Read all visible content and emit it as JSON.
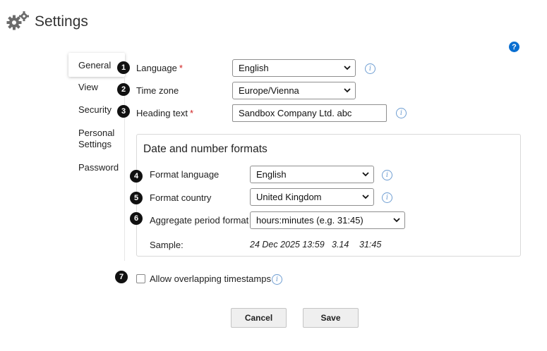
{
  "header": {
    "title": "Settings",
    "icon": "gears-icon",
    "help_glyph": "?"
  },
  "nav": {
    "items": [
      "General",
      "View",
      "Security",
      "Personal Settings",
      "Password"
    ],
    "personal_line1": "Personal",
    "personal_line2": "Settings",
    "active": "General"
  },
  "markers": [
    "1",
    "2",
    "3",
    "4",
    "5",
    "6",
    "7"
  ],
  "form": {
    "language": {
      "label": "Language",
      "required_mark": "*",
      "value": "English"
    },
    "timezone": {
      "label": "Time zone",
      "value": "Europe/Vienna"
    },
    "heading_text": {
      "label": "Heading text",
      "required_mark": "*",
      "value": "Sandbox Company Ltd. abc"
    }
  },
  "formats": {
    "title": "Date and number formats",
    "format_language": {
      "label": "Format language",
      "value": "English"
    },
    "format_country": {
      "label": "Format country",
      "value": "United Kingdom"
    },
    "aggregate_period": {
      "label": "Aggregate period format",
      "value": "hours:minutes (e.g. 31:45)"
    },
    "sample": {
      "label": "Sample:",
      "date": "24 Dec 2025 13:59",
      "number": "3.14",
      "duration": "31:45"
    }
  },
  "overlap": {
    "label": "Allow overlapping timestamps",
    "checked": false
  },
  "info_glyph": "i",
  "buttons": {
    "cancel": "Cancel",
    "save": "Save"
  },
  "colors": {
    "accent": "#0a6fd1",
    "info": "#6f9ed2",
    "required": "#d02020"
  }
}
